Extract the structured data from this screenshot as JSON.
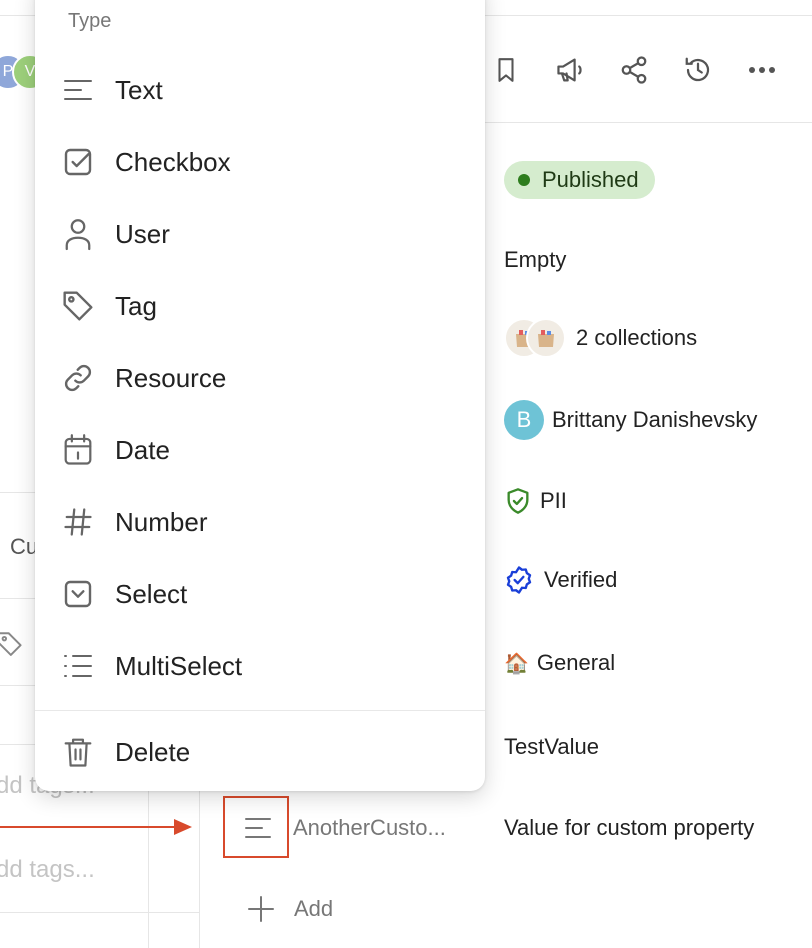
{
  "menu": {
    "header": "Type",
    "items": [
      {
        "label": "Text",
        "icon": "text-lines-icon"
      },
      {
        "label": "Checkbox",
        "icon": "checkbox-icon"
      },
      {
        "label": "User",
        "icon": "user-icon"
      },
      {
        "label": "Tag",
        "icon": "tag-icon"
      },
      {
        "label": "Resource",
        "icon": "link-icon"
      },
      {
        "label": "Date",
        "icon": "calendar-icon"
      },
      {
        "label": "Number",
        "icon": "hash-icon"
      },
      {
        "label": "Select",
        "icon": "select-icon"
      },
      {
        "label": "MultiSelect",
        "icon": "list-icon"
      }
    ],
    "delete_label": "Delete"
  },
  "left_panel": {
    "avatars": [
      "P",
      "V"
    ],
    "cut_label": "Cu",
    "tag_placeholder_1": "dd tags...",
    "tag_placeholder_2": "dd tags..."
  },
  "toolbar": {
    "icons": [
      "bookmark-icon",
      "megaphone-icon",
      "share-icon",
      "history-icon",
      "more-icon"
    ]
  },
  "properties": {
    "status": "Published",
    "empty": "Empty",
    "collections": "2 collections",
    "owner_initial": "B",
    "owner": "Brittany Danishevsky",
    "classification": "PII",
    "certification": "Verified",
    "domain_emoji": "🏠",
    "domain": "General",
    "test_value": "TestValue",
    "custom_property_name": "AnotherCusto...",
    "custom_property_value": "Value for custom property",
    "add_label": "Add"
  },
  "colors": {
    "accent_red": "#d84a2c",
    "published_bg": "#d5ecce",
    "published_dot": "#2e7d1e",
    "pii_green": "#3a8a2a",
    "verified_blue": "#1a3fd8",
    "owner_avatar": "#6ec3d6"
  }
}
